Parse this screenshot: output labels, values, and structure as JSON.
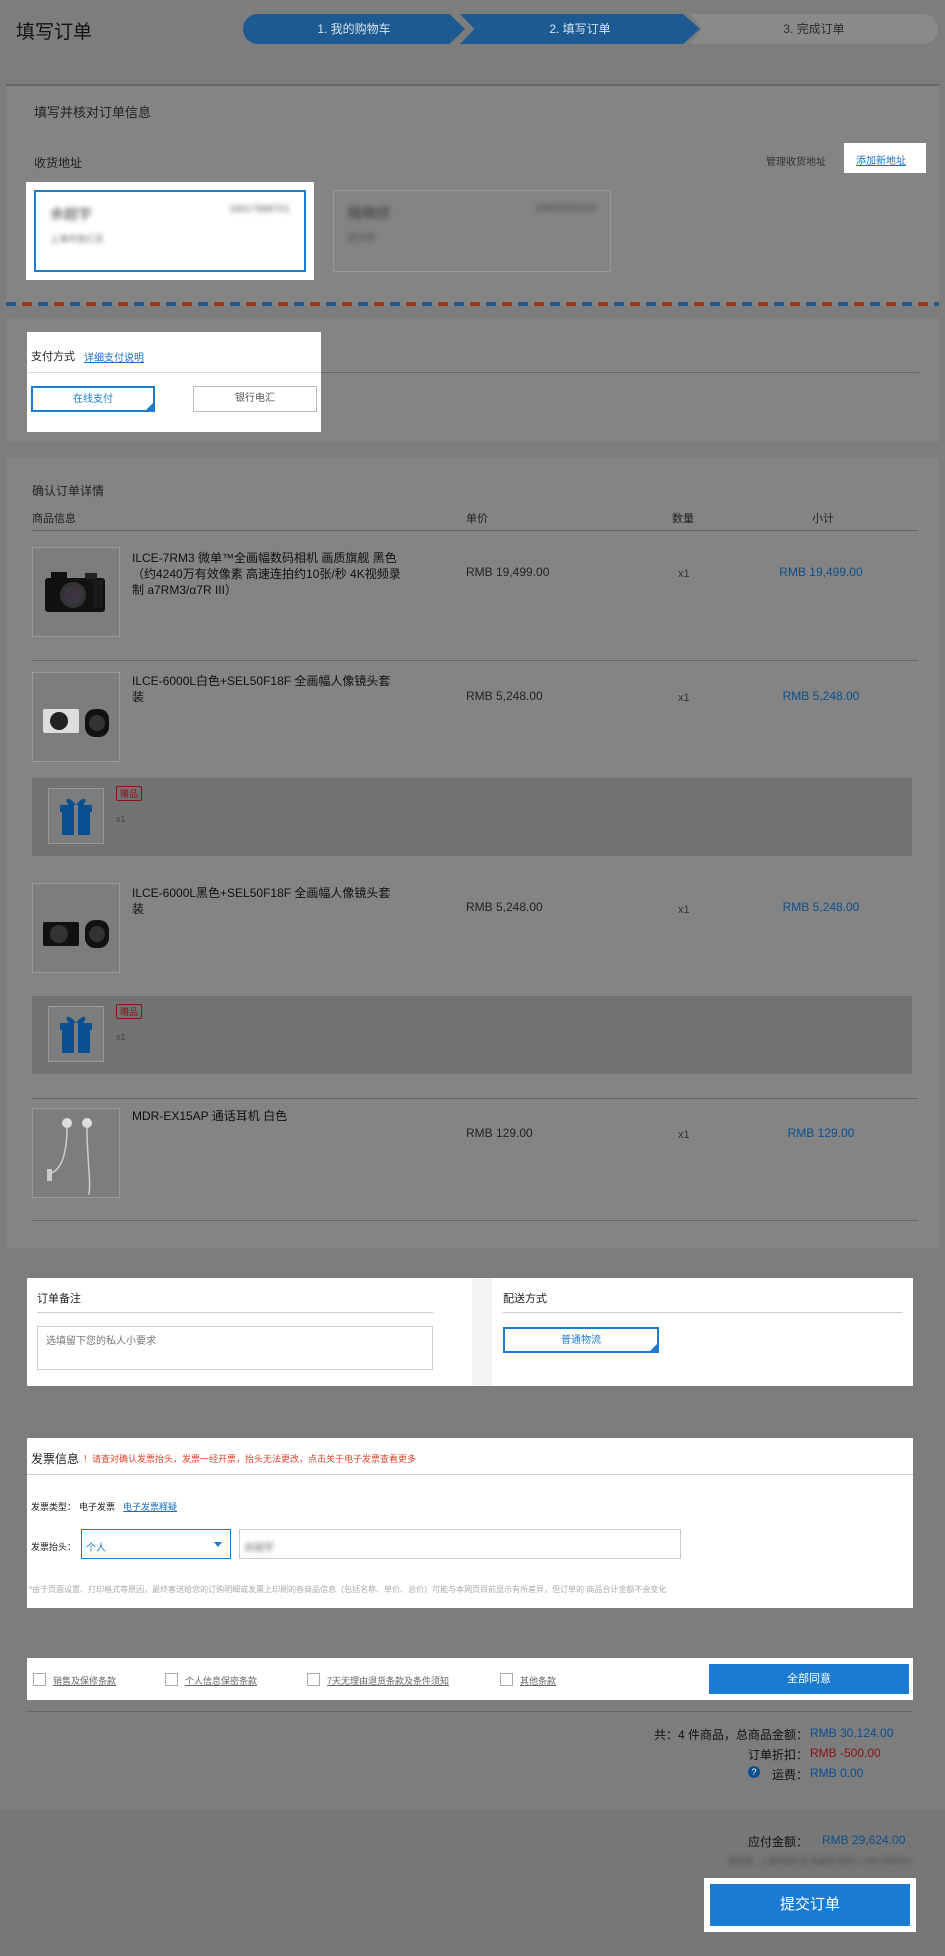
{
  "header": {
    "title": "填写订单",
    "steps": [
      "1. 我的购物车",
      "2. 填写订单",
      "3. 完成订单"
    ]
  },
  "order_info": {
    "title": "填写并核对订单信息",
    "address_label": "收货地址",
    "manage_address": "管理收货地址",
    "add_address": "添加新地址",
    "addresses": [
      {
        "name": "余超宇",
        "phone": "18017888761",
        "detail": "上海市徐汇区"
      },
      {
        "name": "陆晓欣",
        "phone": "13462202219",
        "detail": "武汉市"
      }
    ]
  },
  "payment": {
    "title": "支付方式",
    "detail_link": "详细支付说明",
    "options": [
      "在线支付",
      "银行电汇"
    ]
  },
  "confirm": {
    "title": "确认订单详情",
    "columns": [
      "商品信息",
      "单价",
      "数量",
      "小计"
    ],
    "products": [
      {
        "name": "ILCE-7RM3 微单™全画幅数码相机 画质旗舰 黑色（约4240万有效像素 高速连拍约10张/秒 4K视频录制 a7RM3/α7R III）",
        "price": "RMB 19,499.00",
        "qty": "x1",
        "subtotal": "RMB 19,499.00"
      },
      {
        "name": "ILCE-6000L白色+SEL50F18F 全画幅人像镜头套装",
        "price": "RMB 5,248.00",
        "qty": "x1",
        "subtotal": "RMB 5,248.00"
      },
      {
        "name": "ILCE-6000L黑色+SEL50F18F 全画幅人像镜头套装",
        "price": "RMB 5,248.00",
        "qty": "x1",
        "subtotal": "RMB 5,248.00"
      },
      {
        "name": "MDR-EX15AP 通话耳机 白色",
        "price": "RMB 129.00",
        "qty": "x1",
        "subtotal": "RMB 129.00"
      }
    ],
    "gift": {
      "badge": "赠品",
      "qty": "x1"
    }
  },
  "remark": {
    "title": "订单备注",
    "placeholder": "选填留下您的私人小要求"
  },
  "delivery": {
    "title": "配送方式",
    "option": "普通物流"
  },
  "invoice": {
    "title": "发票信息",
    "warning": "！请查对确认发票抬头，发票一经开票，抬头无法更改，点击关于电子发票查看更多",
    "type_label": "发票类型：",
    "type_value": "电子发票",
    "type_link": "电子发票释疑",
    "header_label": "发票抬头：",
    "header_select": "个人",
    "header_value": "余超宇",
    "note": "*由于页面设置、打印格式等原因，最终客送给您的订购明细或发票上印刷的各商品信息（包括名称、单价、总价）可能与本网页目前显示有所差异，但订单的 商品合计金额不会变化"
  },
  "agreements": {
    "items": [
      "销售及保修条款",
      "个人信息保密条款",
      "7天无理由退货条款及条件须知",
      "其他条款"
    ],
    "agree_all": "全部同意"
  },
  "summary": {
    "total_label": "共：4 件商品，总商品金额：",
    "total_value": "RMB 30,124.00",
    "discount_label": "订单折扣：",
    "discount_value": "RMB -500.00",
    "shipping_label": "运费：",
    "shipping_value": "RMB 0.00",
    "payable_label": "应付金额：",
    "payable_value": "RMB 29,624.00",
    "address_line": "寄送至：上海市徐汇区 余超宇 收货人 18017888761",
    "submit": "提交订单"
  },
  "colors": {
    "accent": "#1a7bd0",
    "dim_overlay": "#7d7d7d",
    "discount": "#8a1212"
  }
}
